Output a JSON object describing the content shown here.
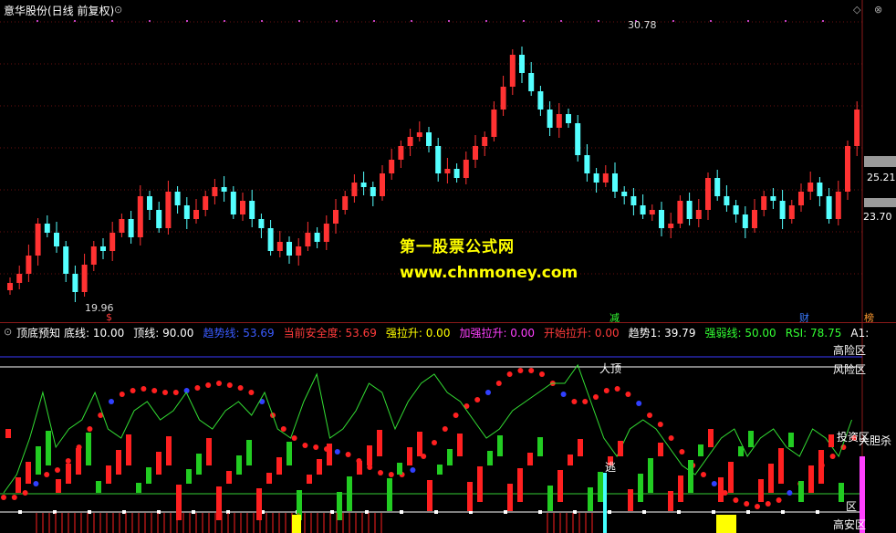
{
  "app": {
    "title": "意华股份(日线 前复权)"
  },
  "price_panel": {
    "high_label": "30.78",
    "low_label": "19.96",
    "right_price_1": "25.21",
    "right_price_2": "23.70",
    "markers": [
      "$",
      "减",
      "财",
      "榜"
    ],
    "watermark_title": "第一股票公式网",
    "watermark_url": "www.chnmoney.com"
  },
  "indicator_panel": {
    "name": "顶底预知",
    "params": [
      {
        "text": "底线: 10.00",
        "color": "#ffffff"
      },
      {
        "text": "顶线: 90.00",
        "color": "#ffffff"
      },
      {
        "text": "趋势线: 53.69",
        "color": "#3a5bff"
      },
      {
        "text": "当前安全度: 53.69",
        "color": "#ff3b3b"
      },
      {
        "text": "强拉升: 0.00",
        "color": "#ffff00"
      },
      {
        "text": "加强拉升: 0.00",
        "color": "#ff40ff"
      },
      {
        "text": "开始拉升: 0.00",
        "color": "#ff3b3b"
      },
      {
        "text": "趋势1: 39.79",
        "color": "#ffffff"
      },
      {
        "text": "强弱线: 50.00",
        "color": "#33ff33"
      },
      {
        "text": "RSI: 78.75",
        "color": "#33ff33"
      },
      {
        "text": "A1:",
        "color": "#ffffff"
      }
    ],
    "zone_labels": [
      "高险区",
      "风险区",
      "投资区",
      "大胆杀",
      "区",
      "高安区"
    ],
    "signal_labels": [
      "大顶",
      "逃"
    ]
  },
  "colors": {
    "up": "#ff3232",
    "down": "#54ffff",
    "bg": "#000000"
  }
}
